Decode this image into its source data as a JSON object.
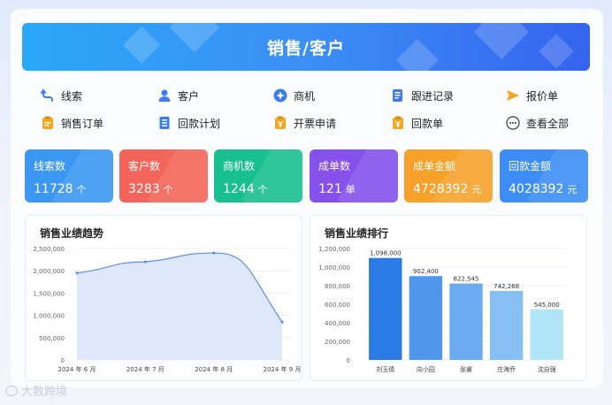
{
  "header": {
    "title": "销售/客户"
  },
  "menu": [
    {
      "label": "线索",
      "icon": "clue-icon",
      "color": "#3d7cf0"
    },
    {
      "label": "客户",
      "icon": "customer-icon",
      "color": "#3d7cf0"
    },
    {
      "label": "商机",
      "icon": "opportunity-icon",
      "color": "#3d7cf0"
    },
    {
      "label": "跟进记录",
      "icon": "followup-record-icon",
      "color": "#3d7cf0"
    },
    {
      "label": "报价单",
      "icon": "quote-icon",
      "color": "#f5a623"
    },
    {
      "label": "销售订单",
      "icon": "sales-order-icon",
      "color": "#f5a623"
    },
    {
      "label": "回款计划",
      "icon": "payment-plan-icon",
      "color": "#3d7cf0"
    },
    {
      "label": "开票申请",
      "icon": "invoice-request-icon",
      "color": "#f5a623"
    },
    {
      "label": "回款单",
      "icon": "payment-receipt-icon",
      "color": "#f5a623"
    },
    {
      "label": "查看全部",
      "icon": "more-icon",
      "color": "#555555"
    }
  ],
  "stats": [
    {
      "label": "线索数",
      "value": "11728",
      "unit": "个",
      "color": "#3c97f3"
    },
    {
      "label": "客户数",
      "value": "3283",
      "unit": "个",
      "color": "#f3655a"
    },
    {
      "label": "商机数",
      "value": "1244",
      "unit": "个",
      "color": "#19c08f"
    },
    {
      "label": "成单数",
      "value": "121",
      "unit": "单",
      "color": "#8551ea"
    },
    {
      "label": "成单金额",
      "value": "4728392",
      "unit": "元",
      "color": "#f7a12b"
    },
    {
      "label": "回款金额",
      "value": "4028392",
      "unit": "元",
      "color": "#3c8ef4"
    }
  ],
  "trend_panel": {
    "title": "销售业绩趋势"
  },
  "rank_panel": {
    "title": "销售业绩排行"
  },
  "watermark": "大数跨境",
  "chart_data": [
    {
      "type": "area",
      "title": "销售业绩趋势",
      "categories": [
        "2024 年 6 月",
        "2024 年 7 月",
        "2024 年 8 月",
        "2024 年 9 月"
      ],
      "values": [
        1950000,
        2200000,
        2400000,
        850000
      ],
      "yticks": [
        "0",
        "500,000",
        "1,000,000",
        "1,500,000",
        "2,000,000",
        "2,500,000"
      ],
      "ylim": [
        0,
        2500000
      ],
      "grid": true,
      "color": "#5b8ff0"
    },
    {
      "type": "bar",
      "title": "销售业绩排行",
      "categories": [
        "刘玉倩",
        "向小园",
        "张睿",
        "庄海乔",
        "沈自强"
      ],
      "values": [
        1098000,
        902400,
        822545,
        742268,
        545000
      ],
      "labels": [
        "1,098,000",
        "902,400",
        "822,545",
        "742,268",
        "545,000"
      ],
      "yticks": [
        "0",
        "200,000",
        "400,000",
        "600,000",
        "800,000",
        "1,000,000",
        "1,200,000"
      ],
      "ylim": [
        0,
        1200000
      ],
      "grid": true,
      "colors": [
        "#2b7be5",
        "#4f97ec",
        "#6aaaf0",
        "#86c0f3",
        "#b2e4f8"
      ]
    }
  ]
}
